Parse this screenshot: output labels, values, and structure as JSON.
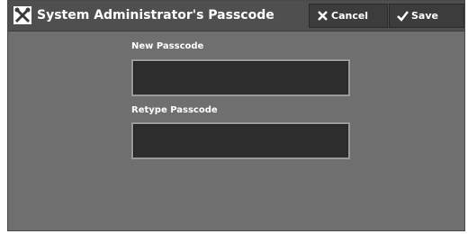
{
  "window": {
    "title": "System Administrator's Passcode",
    "icon": "tools-icon"
  },
  "toolbar": {
    "cancel_label": "Cancel",
    "cancel_icon": "close-icon",
    "save_label": "Save",
    "save_icon": "checkmark-icon"
  },
  "form": {
    "new_passcode": {
      "label": "New Passcode",
      "value": ""
    },
    "retype_passcode": {
      "label": "Retype Passcode",
      "value": ""
    }
  },
  "colors": {
    "background": "#6f6f6f",
    "titlebar": "#4f4f4f",
    "button": "#3c3c3c",
    "field": "#2d2d2d",
    "text": "#ffffff"
  }
}
